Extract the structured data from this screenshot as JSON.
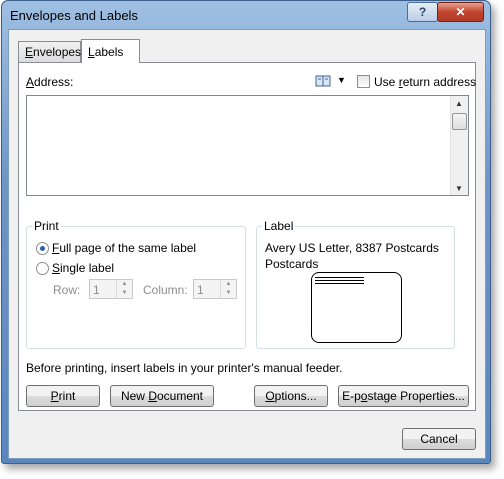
{
  "window": {
    "title": "Envelopes and Labels",
    "help_glyph": "?",
    "close_glyph": "✕"
  },
  "tabs": [
    {
      "label": "Envelopes"
    },
    {
      "label": "Labels"
    }
  ],
  "address": {
    "label": "Address:",
    "value": "",
    "use_return_address": "Use return address",
    "use_return_checked": false,
    "dropdown_glyph": "▼"
  },
  "print_group": {
    "title": "Print",
    "full_page": "Full page of the same label",
    "single_label": "Single label",
    "selected": "full_page",
    "row_label": "Row:",
    "row_value": "1",
    "column_label": "Column:",
    "column_value": "1"
  },
  "label_group": {
    "title": "Label",
    "line1": "Avery US Letter, 8387 Postcards",
    "line2": "Postcards"
  },
  "notice": "Before printing, insert labels in your printer's manual feeder.",
  "buttons": {
    "print": "Print",
    "new_document": "New Document",
    "options": "Options...",
    "epostage": "E-postage Properties...",
    "cancel": "Cancel"
  },
  "icons": {
    "address_book": "address-book-icon"
  }
}
